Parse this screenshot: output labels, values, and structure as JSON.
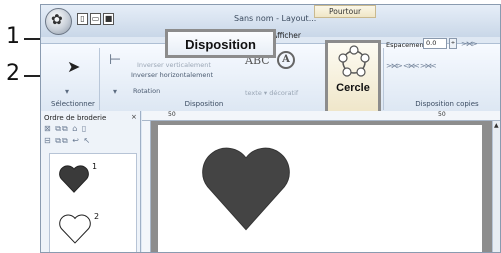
{
  "callouts": {
    "one": "1",
    "two": "2"
  },
  "window": {
    "title": "Sans nom - Layout..."
  },
  "context_tab": {
    "label": "Pourtour"
  },
  "tabs": {
    "image": "nage",
    "afficher": "Afficher"
  },
  "ribbon": {
    "disposition_callout_label": "Disposition",
    "inverser_vertical": "Inverser verticalement",
    "inverser_horizontal": "Inverser horizontalement",
    "rotation": "Rotation",
    "texte_decoratif": "texte ▾  décoratif",
    "cercle_label": "Cercle",
    "espacement_label": "Espacement:",
    "espacement_value": "0.0",
    "groups": {
      "selectionner": "Sélectionner",
      "disposition": "Disposition",
      "disposition_copies": "Disposition copies"
    }
  },
  "panel": {
    "title": "Ordre de broderie",
    "close": "×",
    "items": [
      {
        "number": "1",
        "fill": "#3a3a3a"
      },
      {
        "number": "2",
        "fill": "#ffffff"
      }
    ]
  },
  "ruler": {
    "marks": [
      "50",
      "50"
    ]
  },
  "canvas": {
    "heart_color": "#444444"
  },
  "colors": {
    "accent_callout_border": "#8c8c8c"
  }
}
